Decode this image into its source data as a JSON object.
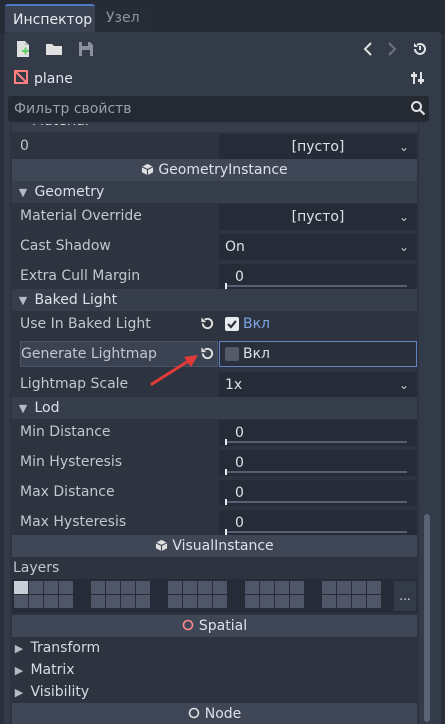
{
  "tabs": [
    {
      "label": "Инспектор",
      "active": true
    },
    {
      "label": "Узел",
      "active": false
    }
  ],
  "toolbar": {
    "icons": [
      "new-resource-icon",
      "open-folder-icon",
      "save-icon",
      "history-back-icon",
      "history-forward-icon",
      "object-history-icon"
    ]
  },
  "object": {
    "name": "plane",
    "icon": "mesh-instance-icon",
    "tools_icon": "tools-icon"
  },
  "search": {
    "placeholder": "Фильтр свойств"
  },
  "material_partial": "Material",
  "material_slot": {
    "index": "0",
    "value": "[пусто]"
  },
  "sections": {
    "geometry_instance": "GeometryInstance",
    "visual_instance": "VisualInstance",
    "spatial": "Spatial",
    "node": "Node"
  },
  "geometry": {
    "title": "Geometry",
    "material_override_label": "Material Override",
    "material_override_value": "[пусто]",
    "cast_shadow_label": "Cast Shadow",
    "cast_shadow_value": "On",
    "extra_cull_margin_label": "Extra Cull Margin",
    "extra_cull_margin_value": "0"
  },
  "baked_light": {
    "title": "Baked Light",
    "use_in_baked_light_label": "Use In Baked Light",
    "use_in_baked_light_value": "Вкл",
    "use_in_baked_light_checked": true,
    "generate_lightmap_label": "Generate Lightmap",
    "generate_lightmap_value": "Вкл",
    "generate_lightmap_checked": false,
    "lightmap_scale_label": "Lightmap Scale",
    "lightmap_scale_value": "1x"
  },
  "lod": {
    "title": "Lod",
    "min_distance_label": "Min Distance",
    "min_distance_value": "0",
    "min_hysteresis_label": "Min Hysteresis",
    "min_hysteresis_value": "0",
    "max_distance_label": "Max Distance",
    "max_distance_value": "0",
    "max_hysteresis_label": "Max Hysteresis",
    "max_hysteresis_value": "0"
  },
  "layers": {
    "label": "Layers",
    "more": "...",
    "active_cells": [
      0
    ]
  },
  "spatial_groups": [
    "Transform",
    "Matrix",
    "Visibility"
  ],
  "colors": {
    "accent": "#4d7cc7",
    "check_on": "#e8ebf0",
    "annotation_arrow": "#e23a3a",
    "highlight_border": "#5f85c4"
  }
}
